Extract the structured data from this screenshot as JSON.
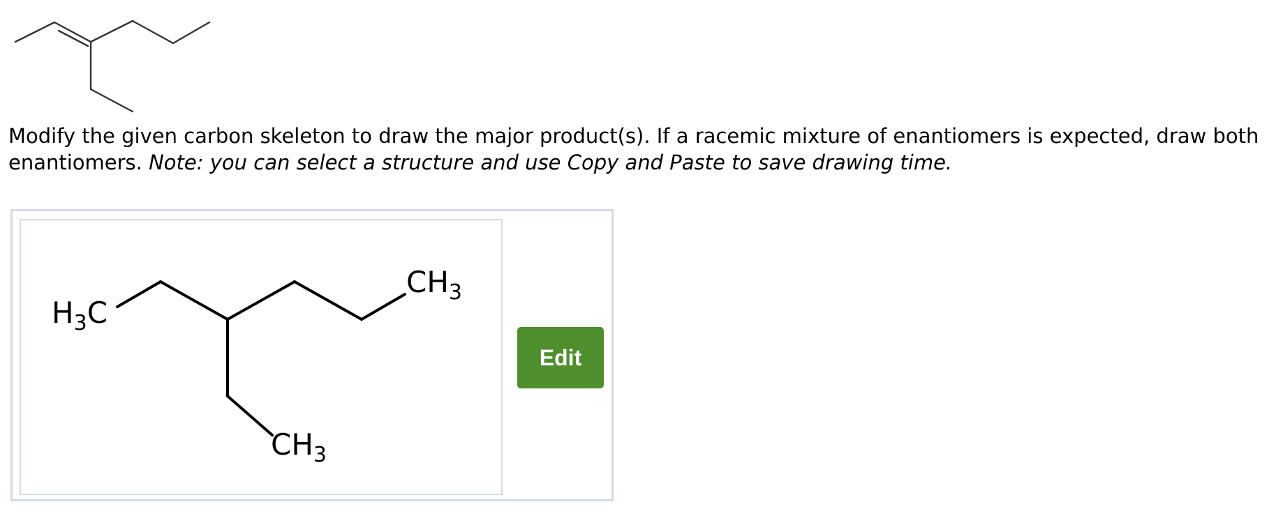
{
  "question": {
    "instruction_text": "Modify the given carbon skeleton to draw the major product(s). If a racemic mixture of enantiomers is expected, draw both enantiomers.",
    "note_text": "Note: you can select a structure and use Copy and Paste to save drawing time."
  },
  "answer_panel": {
    "edit_label": "Edit",
    "edit_button_color": "#4e8e2d",
    "border_color": "#d4dae6",
    "atoms": {
      "left_methyl": {
        "main": "H",
        "sub": "3",
        "tail": "C"
      },
      "right_methyl": {
        "main": "CH",
        "sub": "3"
      },
      "bottom_methyl": {
        "main": "CH",
        "sub": "3"
      }
    }
  }
}
